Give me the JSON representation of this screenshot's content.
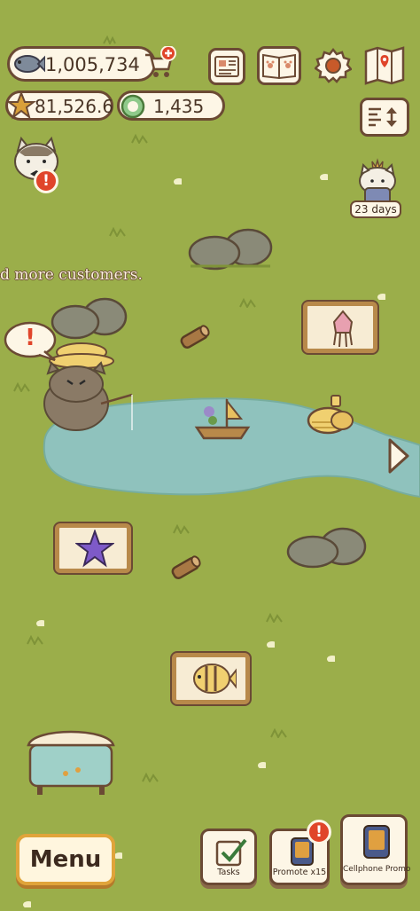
{
  "currencies": {
    "fish": "1,005,734",
    "stars": "81,526.6",
    "gems": "1,435"
  },
  "event_timer": "23 days",
  "marquee": "d more customers.",
  "buttons": {
    "menu": "Menu",
    "tasks": "Tasks",
    "promote": "Promote x15",
    "cellphone_promo": "Cellphone Promo"
  },
  "badges": {
    "alert": "!",
    "speech": "!"
  },
  "colors": {
    "grass": "#9bae4a",
    "pond": "#8fc2bd",
    "wood": "#b8894a",
    "alert_red": "#e0452a",
    "menu_border": "#e0a43a"
  },
  "icons": [
    "fish-icon",
    "cart-plus-icon",
    "newspaper-icon",
    "paw-book-icon",
    "gear-icon",
    "map-icon",
    "star-icon",
    "gem-icon",
    "sort-icon",
    "arrow-right-icon",
    "checkbox-icon",
    "phone-icon"
  ]
}
